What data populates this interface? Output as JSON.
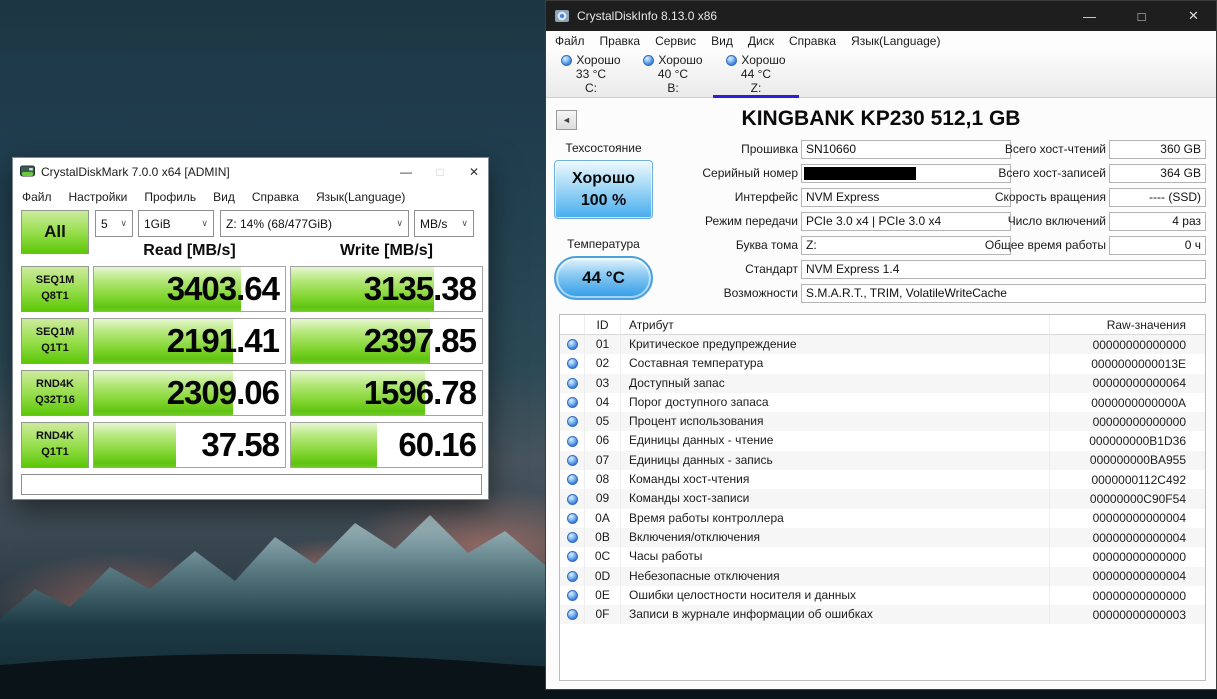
{
  "icons": {
    "minimize": "—",
    "maximize": "□",
    "close": "✕",
    "back": "◄",
    "chevron_down": "∨"
  },
  "colors": {
    "cdm_green": "#5cc708",
    "cdi_accent_blue": "#2f9ce7",
    "tab_underline": "#2e1fd6",
    "titlebar_dark": "#1e1e1e"
  },
  "diskmark": {
    "title": "CrystalDiskMark 7.0.0 x64 [ADMIN]",
    "menu": [
      "Файл",
      "Настройки",
      "Профиль",
      "Вид",
      "Справка",
      "Язык(Language)"
    ],
    "controls": {
      "all_label": "All",
      "count": "5",
      "size": "1GiB",
      "target": "Z: 14% (68/477GiB)",
      "unit": "MB/s"
    },
    "columns": {
      "read": "Read [MB/s]",
      "write": "Write [MB/s]"
    },
    "rows": [
      {
        "test": "SEQ1M",
        "config": "Q8T1",
        "read": "3403.64",
        "write": "3135.38",
        "read_fill": 77,
        "write_fill": 75
      },
      {
        "test": "SEQ1M",
        "config": "Q1T1",
        "read": "2191.41",
        "write": "2397.85",
        "read_fill": 73,
        "write_fill": 73
      },
      {
        "test": "RND4K",
        "config": "Q32T16",
        "read": "2309.06",
        "write": "1596.78",
        "read_fill": 73,
        "write_fill": 70
      },
      {
        "test": "RND4K",
        "config": "Q1T1",
        "read": "37.58",
        "write": "60.16",
        "read_fill": 43,
        "write_fill": 45
      }
    ],
    "comment": ""
  },
  "diskinfo": {
    "title": "CrystalDiskInfo 8.13.0 x86",
    "menu": [
      "Файл",
      "Правка",
      "Сервис",
      "Вид",
      "Диск",
      "Справка",
      "Язык(Language)"
    ],
    "drives": [
      {
        "status": "Хорошо",
        "temp": "33 °C",
        "letter": "C:",
        "selected": false
      },
      {
        "status": "Хорошо",
        "temp": "40 °C",
        "letter": "B:",
        "selected": false
      },
      {
        "status": "Хорошо",
        "temp": "44 °C",
        "letter": "Z:",
        "selected": true
      }
    ],
    "drive_title": "KINGBANK KP230 512,1 GB",
    "health": {
      "label": "Техсостояние",
      "status": "Хорошо",
      "percent": "100 %"
    },
    "temperature": {
      "label": "Температура",
      "value": "44 °C"
    },
    "fields_left": [
      {
        "label": "Прошивка",
        "value": "SN10660",
        "wide": false,
        "redacted": false
      },
      {
        "label": "Серийный номер",
        "value": "",
        "wide": false,
        "redacted": true
      },
      {
        "label": "Интерфейс",
        "value": "NVM Express",
        "wide": false,
        "redacted": false
      },
      {
        "label": "Режим передачи",
        "value": "PCIe 3.0 x4 | PCIe 3.0 x4",
        "wide": false,
        "redacted": false
      },
      {
        "label": "Буква тома",
        "value": "Z:",
        "wide": false,
        "redacted": false
      },
      {
        "label": "Стандарт",
        "value": "NVM Express 1.4",
        "wide": true,
        "redacted": false
      },
      {
        "label": "Возможности",
        "value": "S.M.A.R.T., TRIM, VolatileWriteCache",
        "wide": true,
        "redacted": false
      }
    ],
    "fields_right": [
      {
        "label": "Всего хост-чтений",
        "value": "360 GB"
      },
      {
        "label": "Всего хост-записей",
        "value": "364 GB"
      },
      {
        "label": "Скорость вращения",
        "value": "---- (SSD)"
      },
      {
        "label": "Число включений",
        "value": "4 раз"
      },
      {
        "label": "Общее время работы",
        "value": "0 ч"
      }
    ],
    "smart_table": {
      "headers": {
        "id": "ID",
        "attribute": "Атрибут",
        "raw": "Raw-значения"
      },
      "rows": [
        {
          "id": "01",
          "attribute": "Критическое предупреждение",
          "raw": "00000000000000"
        },
        {
          "id": "02",
          "attribute": "Составная температура",
          "raw": "0000000000013E"
        },
        {
          "id": "03",
          "attribute": "Доступный запас",
          "raw": "00000000000064"
        },
        {
          "id": "04",
          "attribute": "Порог доступного запаса",
          "raw": "0000000000000A"
        },
        {
          "id": "05",
          "attribute": "Процент использования",
          "raw": "00000000000000"
        },
        {
          "id": "06",
          "attribute": "Единицы данных - чтение",
          "raw": "000000000B1D36"
        },
        {
          "id": "07",
          "attribute": "Единицы данных - запись",
          "raw": "000000000BA955"
        },
        {
          "id": "08",
          "attribute": "Команды хост-чтения",
          "raw": "0000000112C492"
        },
        {
          "id": "09",
          "attribute": "Команды хост-записи",
          "raw": "00000000C90F54"
        },
        {
          "id": "0A",
          "attribute": "Время работы контроллера",
          "raw": "00000000000004"
        },
        {
          "id": "0B",
          "attribute": "Включения/отключения",
          "raw": "00000000000004"
        },
        {
          "id": "0C",
          "attribute": "Часы работы",
          "raw": "00000000000000"
        },
        {
          "id": "0D",
          "attribute": "Небезопасные отключения",
          "raw": "00000000000004"
        },
        {
          "id": "0E",
          "attribute": "Ошибки целостности носителя и данных",
          "raw": "00000000000000"
        },
        {
          "id": "0F",
          "attribute": "Записи в журнале информации об ошибках",
          "raw": "00000000000003"
        }
      ]
    }
  }
}
